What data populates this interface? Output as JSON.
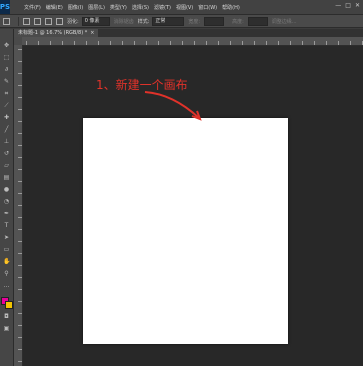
{
  "app": {
    "logo": "PS"
  },
  "menubar": {
    "items": [
      "文件(F)",
      "编辑(E)",
      "图像(I)",
      "图层(L)",
      "类型(Y)",
      "选择(S)",
      "滤镜(T)",
      "视图(V)",
      "窗口(W)",
      "帮助(H)"
    ],
    "window_controls": [
      "—",
      "□",
      "✕"
    ]
  },
  "options": {
    "feather_label": "羽化:",
    "feather_value": "0 像素",
    "antialias_label": "消除锯齿",
    "style_label": "样式:",
    "style_value": "正常",
    "width_label": "宽度:",
    "height_label": "高度:",
    "adjust_edge_label": "调整边缘..."
  },
  "document_tab": {
    "label": "未标题-1 @ 16.7% (RGB/8) *",
    "close": "×"
  },
  "annotation": {
    "text": "1、新建一个画布",
    "color": "#e0322a"
  },
  "colors": {
    "foreground": "#e8009a",
    "background": "#f2c500"
  }
}
